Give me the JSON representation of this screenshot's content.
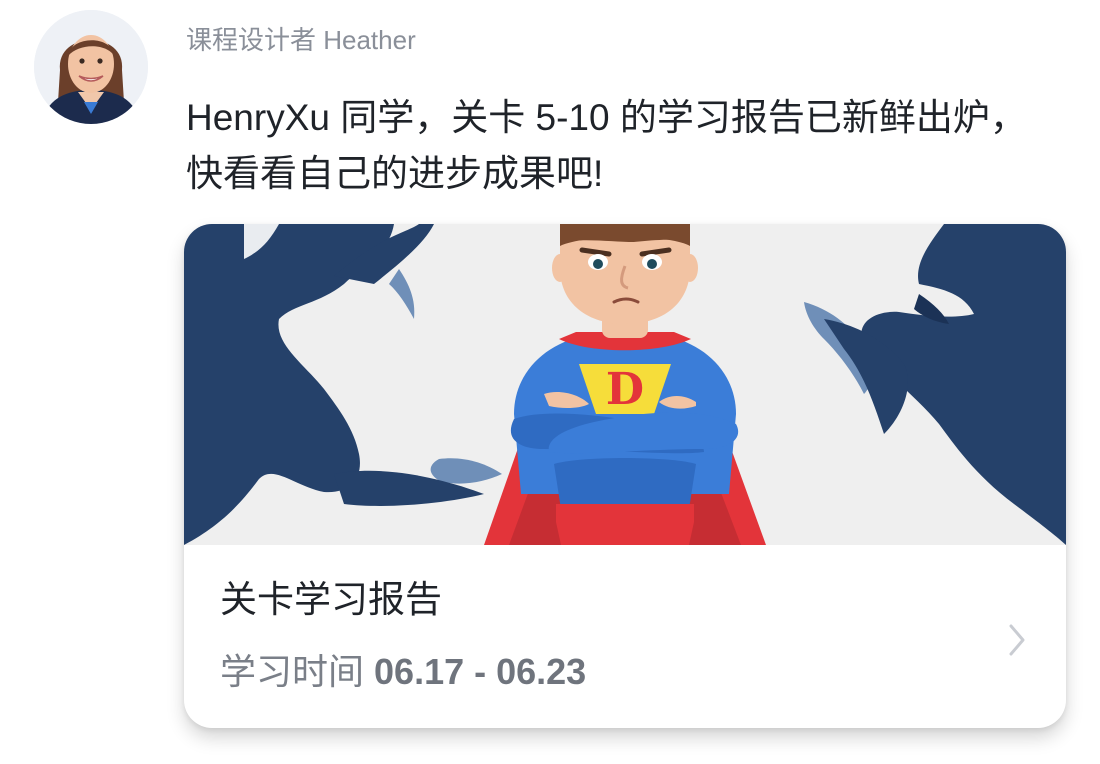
{
  "sender": {
    "name": "课程设计者 Heather",
    "avatar_icon": "teacher-avatar"
  },
  "message": {
    "line1": "HenryXu 同学，关卡 5-10 的学习报告已新鲜出炉，",
    "line2": "快看看自己的进步成果吧!"
  },
  "card": {
    "banner_icon": "superhero-illustration",
    "hero_emblem": "D",
    "title": "关卡学习报告",
    "time_label": "学习时间",
    "time_range": "06.17 - 06.23",
    "chevron_icon": "chevron-right-icon"
  },
  "colors": {
    "banner_bg": "#efefef",
    "monster_navy": "#25416a",
    "hero_blue": "#3b7dd8",
    "cape_red": "#e3343a",
    "emblem_yellow": "#f6dd3a",
    "text_primary": "#1f2329",
    "text_secondary": "#7a7f88"
  }
}
